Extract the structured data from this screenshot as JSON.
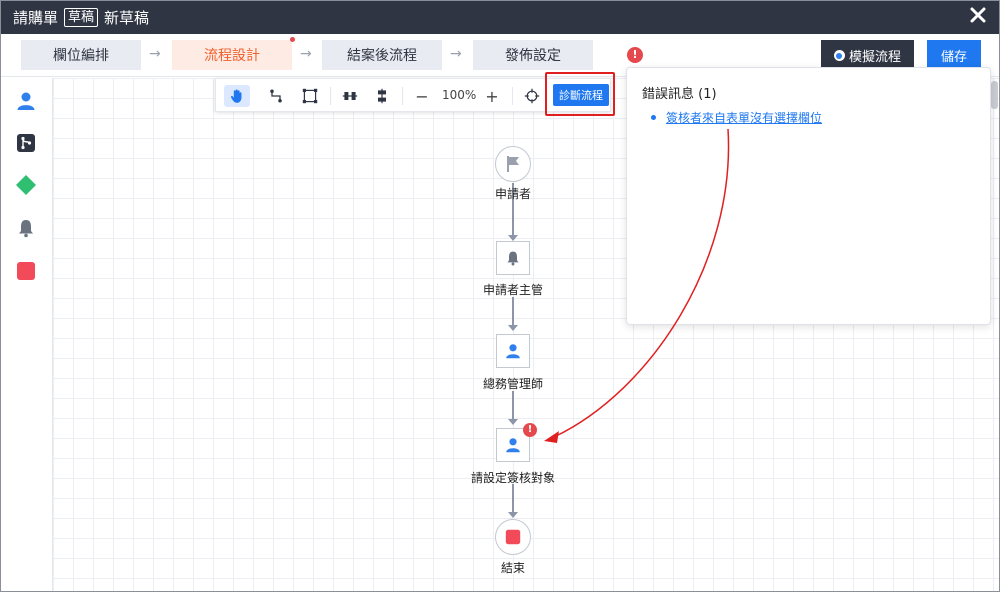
{
  "titlebar": {
    "title": "請購單",
    "badge": "草稿",
    "subtitle": "新草稿"
  },
  "steps": {
    "items": [
      "欄位編排",
      "流程設計",
      "結案後流程",
      "發佈設定"
    ],
    "active_index": 1,
    "arrow": "→",
    "error_count_badge": "!"
  },
  "actions": {
    "simulate_label": "模擬流程",
    "save_label": "儲存"
  },
  "canvas_toolbar": {
    "zoom": "100%",
    "zoom_out": "−",
    "zoom_in": "+",
    "diagnose_label": "診斷流程"
  },
  "toolbox_icons": [
    "person-icon",
    "branch-icon",
    "diamond-icon",
    "bell-icon",
    "stop-icon"
  ],
  "flow": {
    "nodes": [
      {
        "label": "申請者",
        "icon": "flag-icon"
      },
      {
        "label": "申請者主管",
        "icon": "bell-icon"
      },
      {
        "label": "總務管理師",
        "icon": "person-icon"
      },
      {
        "label": "請設定簽核對象",
        "icon": "person-icon",
        "warning": "!"
      },
      {
        "label": "結束",
        "icon": "stop-icon"
      }
    ]
  },
  "error_panel": {
    "title": "錯誤訊息 (1)",
    "errors": [
      "簽核者來自表單沒有選擇欄位"
    ]
  },
  "colors": {
    "accent": "#1f78f0",
    "active_step": "#f0612e",
    "error": "#e5484d",
    "annotation": "#e02020",
    "titlebar": "#2f3542"
  }
}
